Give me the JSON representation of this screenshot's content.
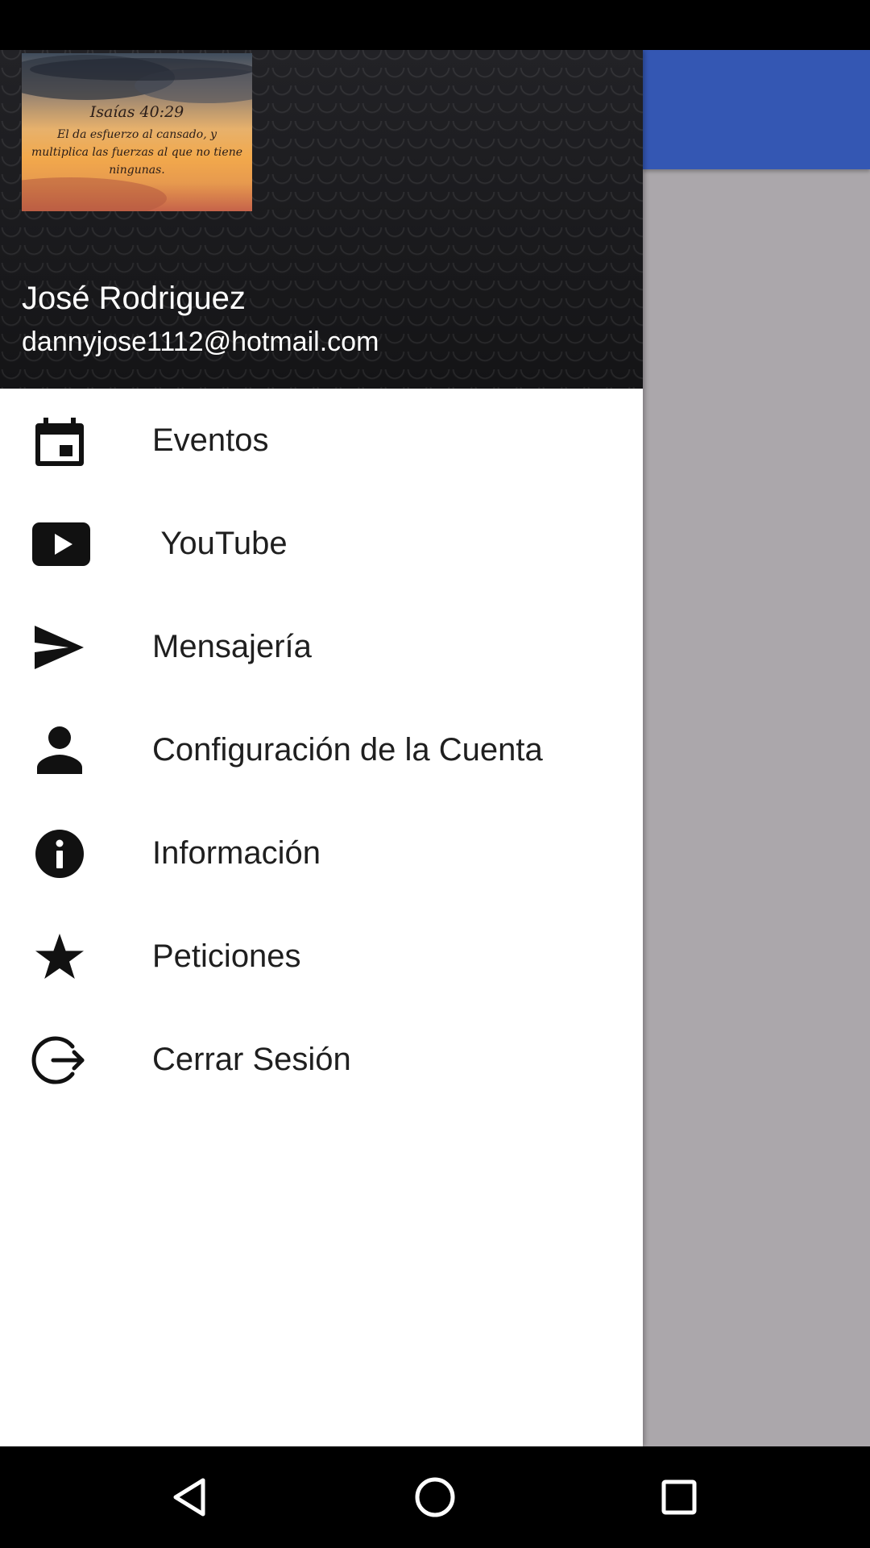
{
  "colors": {
    "toolbar": "#3457b3",
    "scrim": "#aba7ab",
    "drawer_bg": "#ffffff",
    "header_bg": "#1a1a1c",
    "menu_text": "#1f1f1f",
    "icon": "#111111"
  },
  "header": {
    "verse_reference": "Isaías 40:29",
    "verse_text": "El da esfuerzo al cansado, y multiplica las fuerzas al que no tiene ningunas.",
    "user_name": "José Rodriguez",
    "user_email": "dannyjose1112@hotmail.com"
  },
  "menu": {
    "items": [
      {
        "label": "Eventos",
        "icon": "calendar-event-icon"
      },
      {
        "label": " YouTube",
        "icon": "youtube-icon"
      },
      {
        "label": "Mensajería",
        "icon": "send-icon"
      },
      {
        "label": "Configuración de la Cuenta",
        "icon": "person-icon"
      },
      {
        "label": "Información",
        "icon": "info-icon"
      },
      {
        "label": "Peticiones",
        "icon": "star-icon"
      },
      {
        "label": "Cerrar Sesión",
        "icon": "logout-icon"
      }
    ]
  },
  "navigation": {
    "back": "back-icon",
    "home": "home-icon",
    "recents": "recents-icon"
  }
}
